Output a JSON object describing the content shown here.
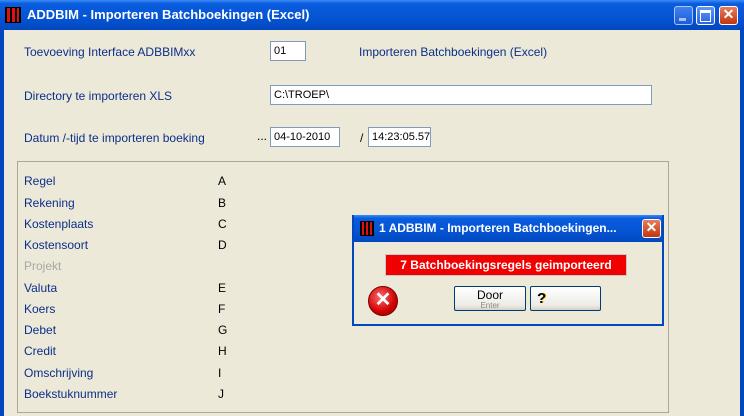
{
  "window": {
    "title": "ADDBIM - Importeren Batchboekingen (Excel)",
    "buttons": {
      "minimize": "minimize-icon",
      "maximize": "maximize-icon",
      "close": "close-icon",
      "close_glyph": "✕"
    }
  },
  "form": {
    "interface_label": "Toevoeving Interface ADBBIMxx",
    "interface_value": "01",
    "interface_desc": "Importeren Batchboekingen (Excel)",
    "directory_label": "Directory te importeren XLS",
    "directory_value": "C:\\TROEP\\",
    "datetime_label": "Datum /-tijd te importeren boeking",
    "datetime_dots": "...",
    "date_value": "04-10-2010",
    "separator": "/",
    "time_value": "14:23:05.57"
  },
  "mapping": [
    {
      "label": "Regel",
      "col": "A"
    },
    {
      "label": "Rekening",
      "col": "B"
    },
    {
      "label": "Kostenplaats",
      "col": "C"
    },
    {
      "label": "Kostensoort",
      "col": "D"
    },
    {
      "label": "Projekt",
      "col": ""
    },
    {
      "label": "Valuta",
      "col": "E"
    },
    {
      "label": "Koers",
      "col": "F"
    },
    {
      "label": "Debet",
      "col": "G"
    },
    {
      "label": "Credit",
      "col": "H"
    },
    {
      "label": "Omschrijving",
      "col": "I"
    },
    {
      "label": "Boekstuknummer",
      "col": "J"
    }
  ],
  "dialog": {
    "title": "1 ADBBIM - Importeren Batchboekingen...",
    "close_glyph": "✕",
    "message": "7 Batchboekingsregels geimporteerd",
    "error_glyph": "✕",
    "door_label": "Door",
    "door_hint": "Enter",
    "help_glyph": "?"
  },
  "colors": {
    "titlebar": "#0554d4",
    "label": "#0b2f8a",
    "message_bg": "#f00000",
    "background": "#ece9d8"
  }
}
